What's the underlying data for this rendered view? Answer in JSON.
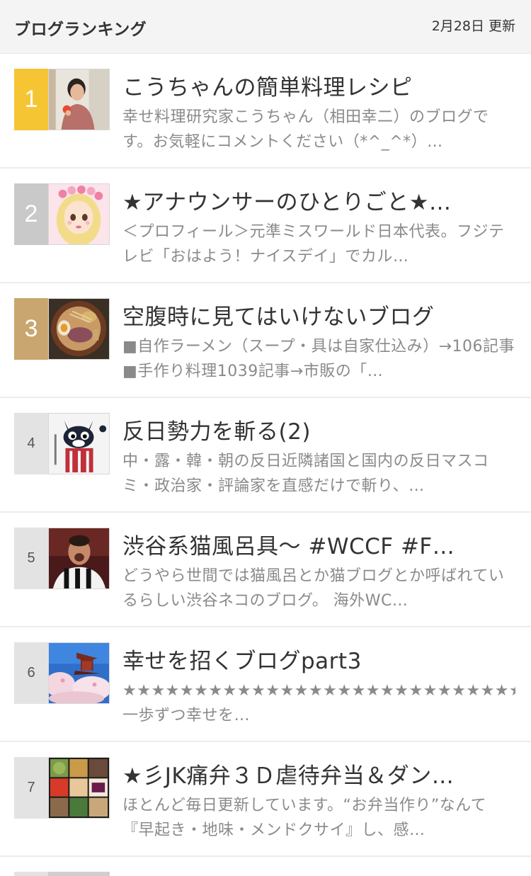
{
  "header": {
    "title": "ブログランキング",
    "updated": "2月28日 更新"
  },
  "colors": {
    "rank1": "#f5c534",
    "rank2": "#c9c9c9",
    "rank3": "#c9a66f",
    "rank_other": "#e3e3e3",
    "title_text": "#333333",
    "desc_text": "#8a8a8a"
  },
  "items": [
    {
      "rank": "1",
      "title": "こうちゃんの簡単料理レシピ",
      "desc": "幸せ料理研究家こうちゃん（相田幸二）のブログです。お気軽にコメントください（*^_^*）…",
      "thumb_icon": "person-photo-icon"
    },
    {
      "rank": "2",
      "title": "★アナウンサーのひとりごと★…",
      "desc": "＜プロフィール＞元準ミスワールド日本代表。フジテレビ「おはよう！ナイスデイ」でカル…",
      "thumb_icon": "anime-girl-icon"
    },
    {
      "rank": "3",
      "title": "空腹時に見てはいけないブログ",
      "desc": "■自作ラーメン（スープ・具は自家仕込み）→106記事■手作り料理1039記事→市販の「…",
      "thumb_icon": "ramen-bowl-icon"
    },
    {
      "rank": "4",
      "title": "反日勢力を斬る(2)",
      "desc": "中・露・韓・朝の反日近隣諸国と国内の反日マスコミ・政治家・評論家を直感だけで斬り、…",
      "thumb_icon": "cartoon-cat-icon"
    },
    {
      "rank": "5",
      "title": "渋谷系猫風呂具〜 #WCCF #F…",
      "desc": "どうやら世間では猫風呂とか猫ブログとか呼ばれているらしい渋谷ネコのブログ。 海外WC…",
      "thumb_icon": "soccer-player-icon"
    },
    {
      "rank": "6",
      "title": "幸せを招くブログpart3",
      "desc": "★★★★★★★★★★★★★★★★★★★★★★★★★★★★★★★★★★★★★★★★★ 一歩ずつ幸せを…",
      "thumb_icon": "cherry-blossom-temple-icon"
    },
    {
      "rank": "7",
      "title": "★彡JK痛弁３Ｄ虐待弁当＆ダン…",
      "desc": "ほとんど毎日更新しています。“お弁当作り”なんて『早起き・地味・メンドクサイ』し、感…",
      "thumb_icon": "bento-collage-icon"
    }
  ]
}
